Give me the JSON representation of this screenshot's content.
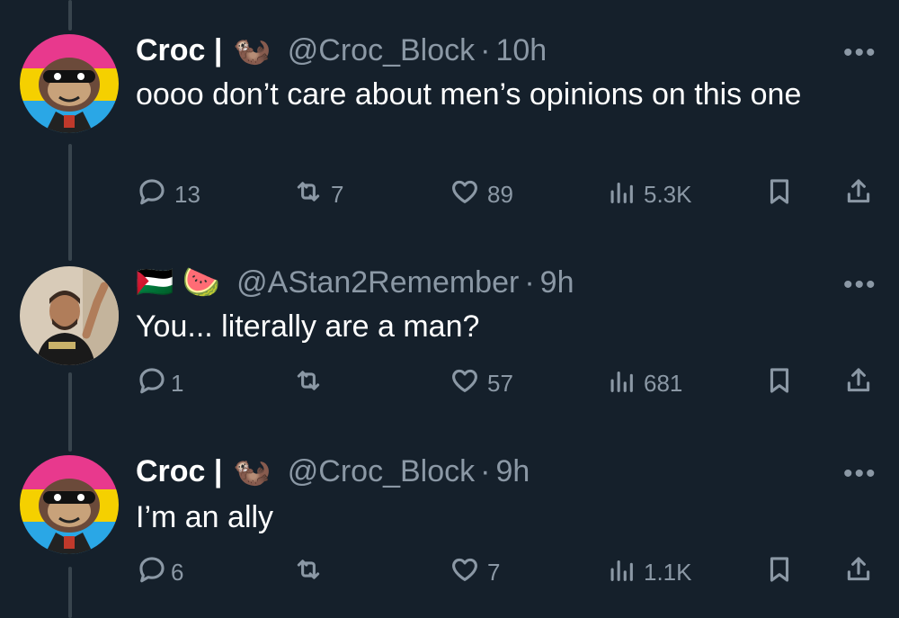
{
  "tweets": [
    {
      "name": "Croc |",
      "emoji": "🦦",
      "handle": "@Croc_Block",
      "time": "10h",
      "text": "oooo don’t care about men’s opinions on this one",
      "replies": "13",
      "retweets": "7",
      "likes": "89",
      "views": "5.3K"
    },
    {
      "name": "",
      "emoji": "🇵🇸 🍉",
      "handle": "@AStan2Remember",
      "time": "9h",
      "text": "You... literally are a man?",
      "replies": "1",
      "retweets": "",
      "likes": "57",
      "views": "681"
    },
    {
      "name": "Croc |",
      "emoji": "🦦",
      "handle": "@Croc_Block",
      "time": "9h",
      "text": "I’m an ally",
      "replies": "6",
      "retweets": "",
      "likes": "7",
      "views": "1.1K"
    }
  ],
  "ui": {
    "dot": "·",
    "more": "•••"
  },
  "colors": {
    "background": "#15202b",
    "secondary_text": "#8b98a5",
    "thread_line": "#38444d"
  }
}
